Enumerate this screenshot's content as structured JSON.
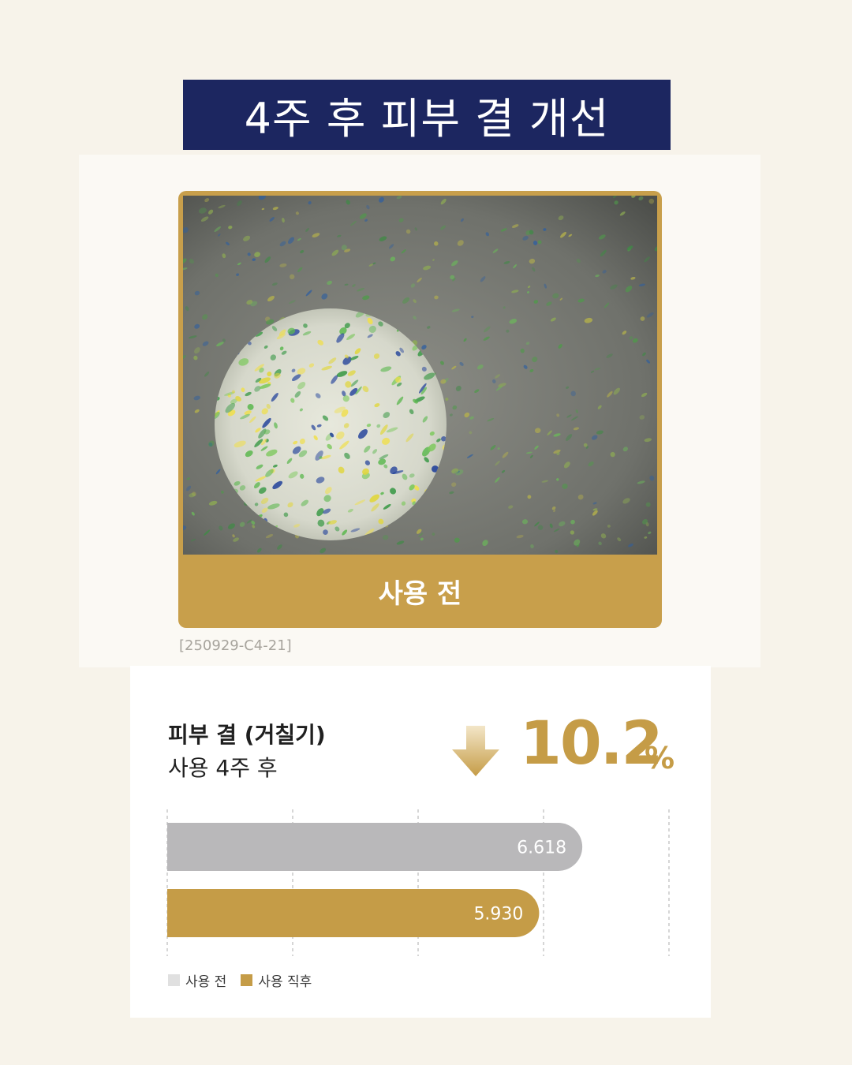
{
  "title": "4주 후 피부 결 개선",
  "photo": {
    "caption": "사용 전",
    "code": "[250929-C4-21]"
  },
  "metric": {
    "label": "피부 결 (거칠기)",
    "sublabel": "사용 4주 후",
    "change_value": "10.2",
    "change_unit": "%",
    "direction": "down"
  },
  "colors": {
    "navy": "#1c2660",
    "gold": "#c89f4b",
    "gray_bar": "#b9b8ba",
    "legend_gray": "#e0e0e0"
  },
  "chart_data": {
    "type": "bar",
    "orientation": "horizontal",
    "categories": [
      "사용 전",
      "사용 직후"
    ],
    "values": [
      6.618,
      5.93
    ],
    "value_labels": [
      "6.618",
      "5.930"
    ],
    "xlim": [
      0,
      8
    ],
    "grid": true,
    "legend": [
      {
        "name": "사용 전",
        "color": "#e0e0e0"
      },
      {
        "name": "사용 직후",
        "color": "#c59c47"
      }
    ],
    "bar_colors": [
      "#b9b8ba",
      "#c59c47"
    ]
  }
}
